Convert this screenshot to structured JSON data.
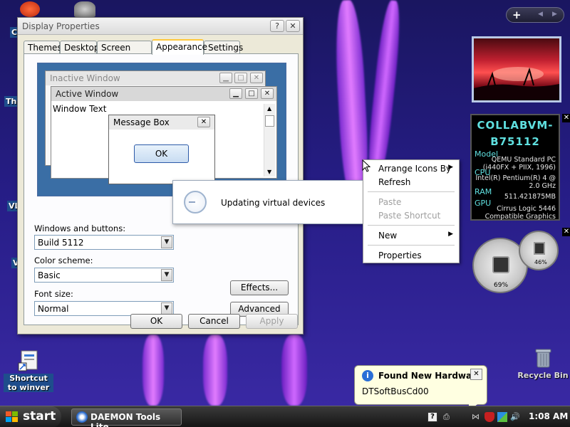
{
  "desktop": {
    "shortcut_label": "Shortcut to winver",
    "recycle_label": "Recycle Bin",
    "edge_labels": [
      "C",
      "Thi",
      "VL",
      "V"
    ]
  },
  "display_properties": {
    "title": "Display Properties",
    "tabs": [
      "Themes",
      "Desktop",
      "Screen Saver",
      "Appearance",
      "Settings"
    ],
    "active_tab": "Appearance",
    "preview": {
      "inactive_title": "Inactive Window",
      "active_title": "Active Window",
      "window_text": "Window Text",
      "message_box_title": "Message Box",
      "message_box_ok": "OK"
    },
    "windows_buttons_label": "Windows and buttons:",
    "windows_buttons_value": "Build 5112",
    "color_scheme_label": "Color scheme:",
    "color_scheme_value": "Basic",
    "font_size_label": "Font size:",
    "font_size_value": "Normal",
    "effects_button": "Effects...",
    "advanced_button": "Advanced",
    "ok_button": "OK",
    "cancel_button": "Cancel",
    "apply_button": "Apply"
  },
  "busy_dialog": {
    "message": "Updating virtual devices"
  },
  "context_menu": {
    "items": [
      {
        "label": "Arrange Icons By",
        "enabled": true,
        "submenu": true
      },
      {
        "label": "Refresh",
        "enabled": true,
        "submenu": false
      },
      {
        "label": "Paste",
        "enabled": false,
        "submenu": false
      },
      {
        "label": "Paste Shortcut",
        "enabled": false,
        "submenu": false
      },
      {
        "label": "New",
        "enabled": true,
        "submenu": true
      },
      {
        "label": "Properties",
        "enabled": true,
        "submenu": false
      }
    ]
  },
  "sysinfo": {
    "name_line1": "COLLABVM-",
    "name_line2": "B75112",
    "model_label": "Model",
    "model_value_1": "QEMU Standard PC",
    "model_value_2": "(i440FX + PIIX, 1996)",
    "cpu_label": "CPU",
    "cpu_value_1": "Intel(R) Pentium(R) 4 @",
    "cpu_value_2": "2.0 GHz",
    "ram_label": "RAM",
    "ram_value": "511.421875MB",
    "gpu_label": "GPU",
    "gpu_value_1": "Cirrus Logic 5446",
    "gpu_value_2": "Compatible Graphics"
  },
  "meters": {
    "cpu_percent_label": "69%",
    "ram_percent_label": "46%",
    "cpu_percent": 69,
    "ram_percent": 46
  },
  "notification": {
    "title": "Found New Hardware",
    "message": "DTSoftBusCd00"
  },
  "taskbar": {
    "start_label": "start",
    "task_label": "DAEMON Tools Lite",
    "clock": "1:08 AM"
  },
  "colors": {
    "desktop": "#261d86",
    "sysinfo_text": "#5fe0e0",
    "selected_tab": "#ffc83c"
  }
}
